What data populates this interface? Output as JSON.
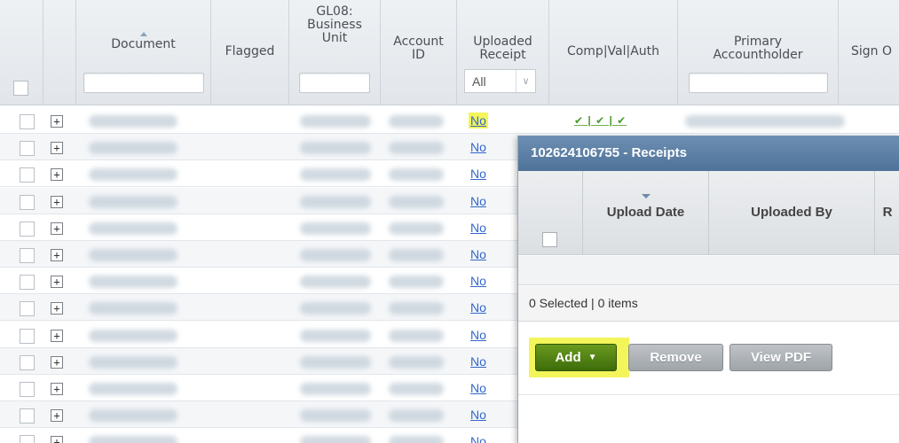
{
  "grid": {
    "columns": {
      "document": "Document",
      "flagged": "Flagged",
      "business_unit": "GL08:\nBusiness\nUnit",
      "account_id": "Account\nID",
      "uploaded_receipt": "Uploaded\nReceipt",
      "comp_val_auth": "Comp|Val|Auth",
      "primary_accountholder": "Primary\nAccountholder",
      "sign_off": "Sign O"
    },
    "uploaded_filter_value": "All",
    "rows": [
      {
        "uploaded": "No",
        "highlighted": true,
        "cva": "✔ | ✔ | ✔"
      },
      {
        "uploaded": "No"
      },
      {
        "uploaded": "No"
      },
      {
        "uploaded": "No"
      },
      {
        "uploaded": "No"
      },
      {
        "uploaded": "No"
      },
      {
        "uploaded": "No"
      },
      {
        "uploaded": "No"
      },
      {
        "uploaded": "No"
      },
      {
        "uploaded": "No"
      },
      {
        "uploaded": "No"
      },
      {
        "uploaded": "No"
      },
      {
        "uploaded": "No"
      }
    ],
    "expand_glyph": "+"
  },
  "popup": {
    "title": "102624106755 - Receipts",
    "col_upload_date": "Upload Date",
    "col_uploaded_by": "Uploaded By",
    "col_cut": "R",
    "status": "0 Selected | 0 items",
    "add_label": "Add",
    "add_caret": "▼",
    "remove_label": "Remove",
    "view_pdf_label": "View PDF"
  },
  "colors": {
    "highlight": "#f3f55a",
    "link": "#3366cc",
    "add_button": "#4f8214",
    "popup_header": "#5d80a6"
  }
}
